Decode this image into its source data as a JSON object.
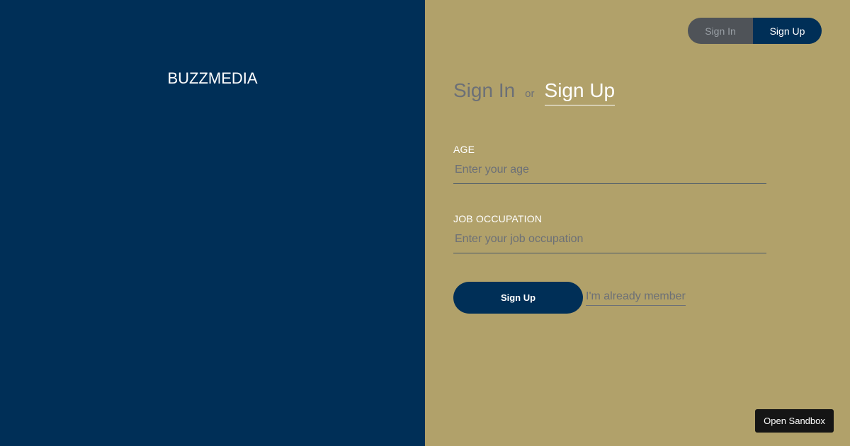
{
  "brand": {
    "name": "BUZZMEDIA"
  },
  "top_toggle": {
    "signin_label": "Sign In",
    "signup_label": "Sign Up"
  },
  "form_title": {
    "signin_label": "Sign In",
    "or_label": "or",
    "signup_label": "Sign Up"
  },
  "form": {
    "age": {
      "label": "AGE",
      "placeholder": "Enter your age",
      "value": ""
    },
    "job": {
      "label": "JOB OCCUPATION",
      "placeholder": "Enter your job occupation",
      "value": ""
    },
    "submit_label": "Sign Up",
    "member_link": "I'm already member"
  },
  "sandbox": {
    "label": "Open Sandbox"
  },
  "colors": {
    "left_background": "#002f57",
    "right_background": "#b1a16a",
    "accent": "#002f57",
    "muted": "#6c7077"
  }
}
